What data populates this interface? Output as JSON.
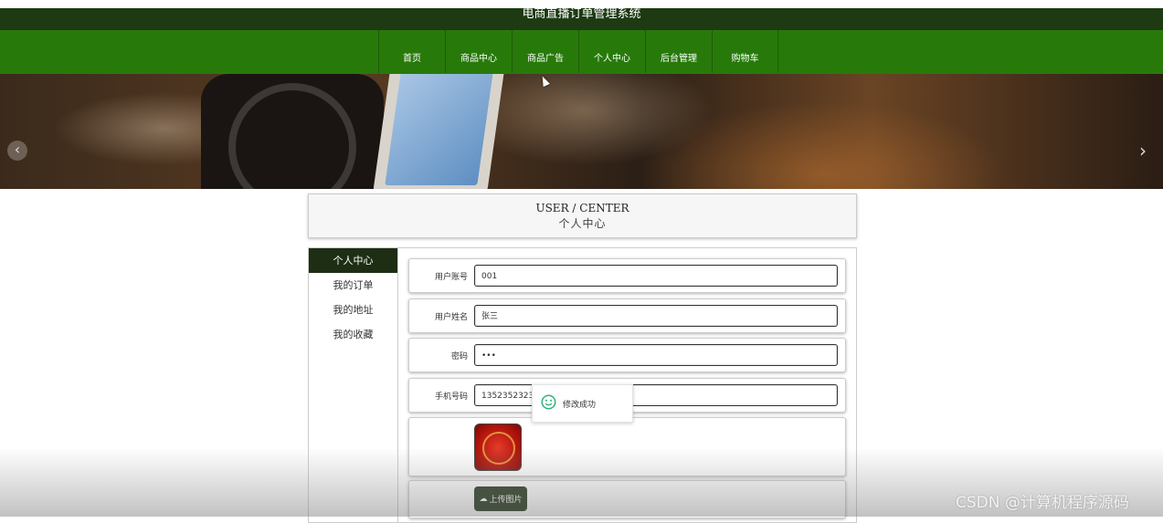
{
  "header": {
    "title": "电商直播订单管理系统"
  },
  "nav": {
    "items": [
      "首页",
      "商品中心",
      "商品广告",
      "个人中心",
      "后台管理",
      "购物车"
    ]
  },
  "carousel": {
    "prev_icon": "‹",
    "next_icon": "›",
    "slide_count": 3,
    "active_index": 0
  },
  "page_title": {
    "en": "USER / CENTER",
    "cn": "个人中心"
  },
  "sidebar": {
    "items": [
      "个人中心",
      "我的订单",
      "我的地址",
      "我的收藏"
    ],
    "active_index": 0
  },
  "form": {
    "account_label": "用户账号",
    "account_value": "001",
    "name_label": "用户姓名",
    "name_value": "张三",
    "password_label": "密码",
    "password_value": "•••",
    "phone_label": "手机号码",
    "phone_value": "13523523235"
  },
  "upload": {
    "label": "上传图片",
    "icon": "cloud-upload-icon"
  },
  "toast": {
    "message": "修改成功",
    "icon": "smile-icon"
  },
  "watermark": "CSDN @计算机程序源码",
  "colors": {
    "nav_bg": "#277a0a",
    "topbar_bg": "#1e3a12",
    "dark_accent": "#1d2e14",
    "dot_active": "#2fb41a",
    "toast_icon": "#2fb47a"
  }
}
